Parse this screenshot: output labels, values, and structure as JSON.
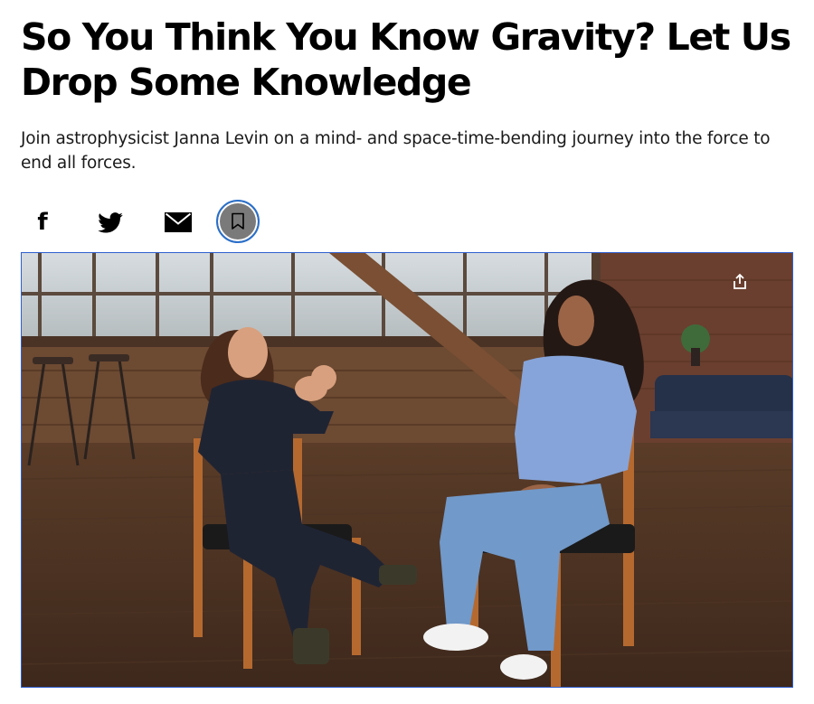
{
  "article": {
    "headline": "So You Think You Know Gravity? Let Us Drop Some Knowledge",
    "dek": "Join astrophysicist Janna Levin on a mind- and space-time-bending journey into the force to end all forces."
  },
  "share_bar": {
    "items": [
      {
        "name": "facebook",
        "icon": "facebook-icon"
      },
      {
        "name": "twitter",
        "icon": "twitter-icon"
      },
      {
        "name": "email",
        "icon": "envelope-icon"
      },
      {
        "name": "save",
        "icon": "bookmark-icon"
      }
    ],
    "facebook_glyph": "f"
  },
  "video": {
    "icon": "share-icon",
    "scene": "two-women-seated-in-chairs-interview"
  },
  "colors": {
    "focus_ring": "#2a6fc9",
    "save_button_fill": "#7a7a7a",
    "video_border": "#2f5fd0"
  }
}
